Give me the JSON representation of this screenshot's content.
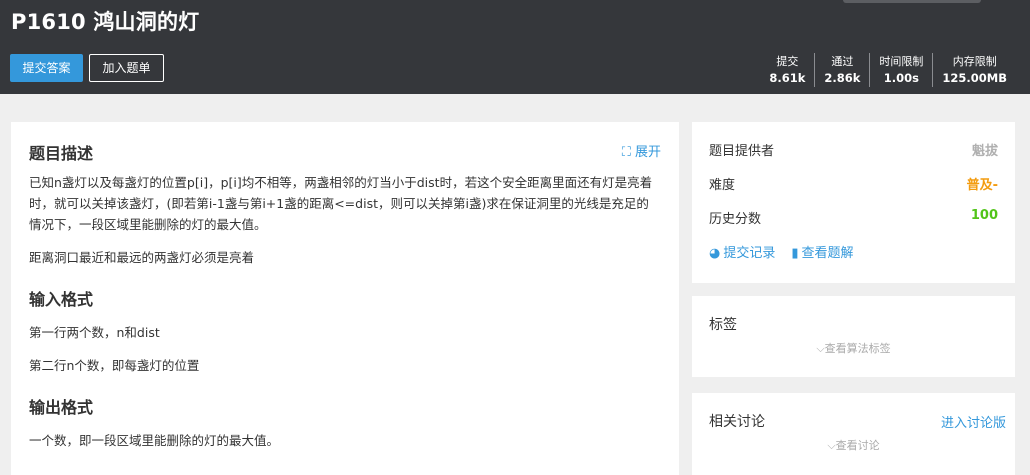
{
  "header": {
    "title": "P1610 鸿山洞的灯",
    "submit_label": "提交答案",
    "add_label": "加入题单",
    "stats": [
      {
        "label": "提交",
        "value": "8.61k"
      },
      {
        "label": "通过",
        "value": "2.86k"
      },
      {
        "label": "时间限制",
        "value": "1.00s"
      },
      {
        "label": "内存限制",
        "value": "125.00MB"
      }
    ]
  },
  "main": {
    "desc_title": "题目描述",
    "expand_label": "展开",
    "desc_p1": "已知n盏灯以及每盏灯的位置p[i]，p[i]均不相等，两盏相邻的灯当小于dist时，若这个安全距离里面还有灯是亮着时，就可以关掉该盏灯，(即若第i-1盏与第i+1盏的距离<=dist，则可以关掉第i盏)求在保证洞里的光线是充足的情况下，一段区域里能删除的灯的最大值。",
    "desc_p2": "距离洞口最近和最远的两盏灯必须是亮着",
    "input_title": "输入格式",
    "input_p1": "第一行两个数，n和dist",
    "input_p2": "第二行n个数，即每盏灯的位置",
    "output_title": "输出格式",
    "output_p1": "一个数，即一段区域里能删除的灯的最大值。"
  },
  "side": {
    "provider_label": "题目提供者",
    "provider_value": "魁拔",
    "difficulty_label": "难度",
    "difficulty_value": "普及-",
    "score_label": "历史分数",
    "score_value": "100",
    "records_label": "提交记录",
    "solutions_label": "查看题解",
    "tags_title": "标签",
    "tags_hint": "查看算法标签",
    "discuss_title": "相关讨论",
    "discuss_link": "进入讨论版",
    "discuss_hint": "查看讨论"
  },
  "colors": {
    "accent": "#3498db",
    "header_bg": "#35373b",
    "difficulty": "#f39c11",
    "score": "#52c41a"
  },
  "icons": [
    "expand-icon",
    "pie-chart-icon",
    "book-icon",
    "chevron-down-icon"
  ]
}
